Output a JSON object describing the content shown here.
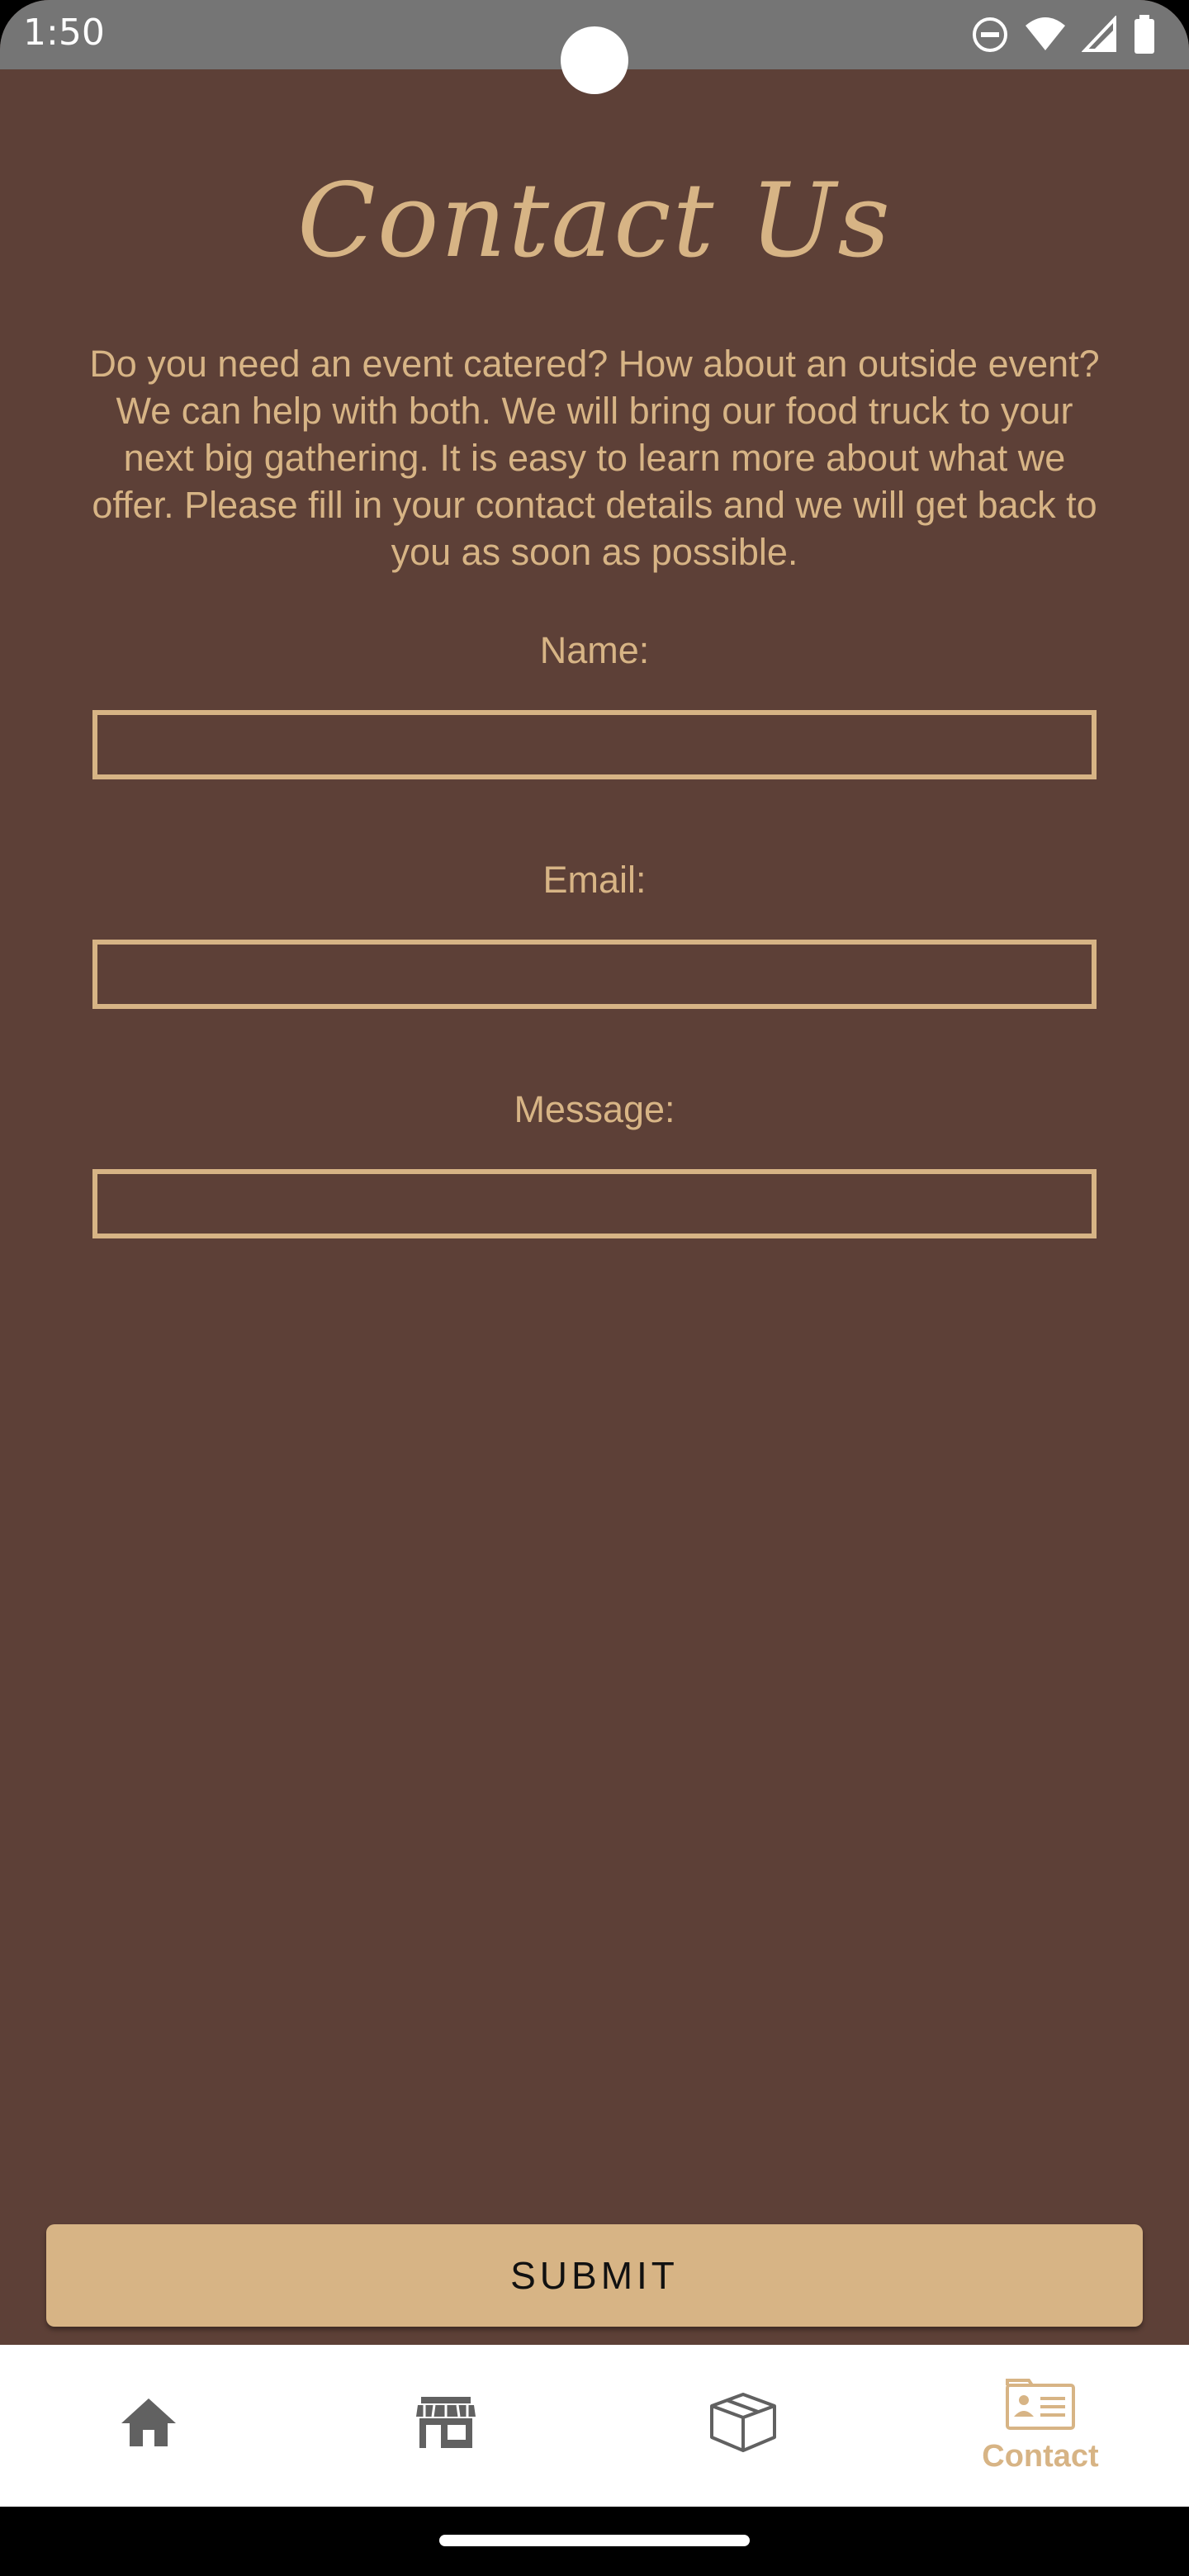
{
  "status_bar": {
    "time": "1:50",
    "icons": [
      "do-not-disturb-icon",
      "wifi-icon",
      "signal-icon",
      "battery-icon"
    ]
  },
  "page": {
    "title": "Contact Us",
    "intro": "Do you need an event catered? How about an outside event? We can help with both. We will bring our food truck to your next big gathering. It is easy to learn more about what we offer. Please fill in your contact details and we will get back to you as soon as possible."
  },
  "form": {
    "name_label": "Name:",
    "name_value": "",
    "email_label": "Email:",
    "email_value": "",
    "message_label": "Message:",
    "message_value": "",
    "submit_label": "SUBMIT"
  },
  "bottom_nav": {
    "items": [
      {
        "icon": "home-icon",
        "label": "",
        "active": false
      },
      {
        "icon": "store-icon",
        "label": "",
        "active": false
      },
      {
        "icon": "box-icon",
        "label": "",
        "active": false
      },
      {
        "icon": "contact-card-icon",
        "label": "Contact",
        "active": true
      }
    ]
  },
  "colors": {
    "background": "#5D4037",
    "accent": "#D7B485",
    "nav_inactive": "#616161",
    "nav_background": "#FFFFFF"
  }
}
